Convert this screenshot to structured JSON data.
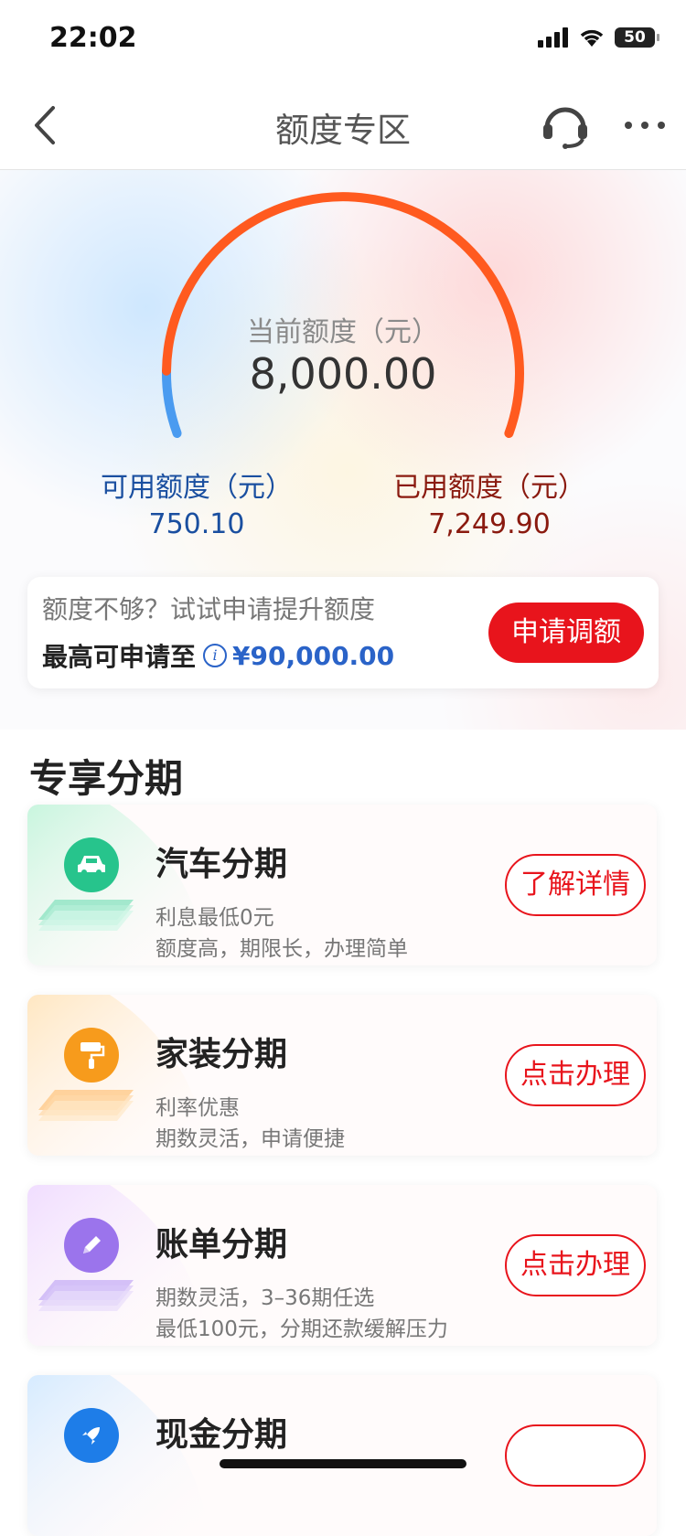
{
  "status_bar": {
    "time": "22:02",
    "battery": "50",
    "icons": [
      "signal-icon",
      "wifi-icon",
      "battery-icon"
    ]
  },
  "nav": {
    "title": "额度专区",
    "back_icon": "chevron-left-icon",
    "service_icon": "headset-icon",
    "more_icon": "more-icon"
  },
  "gauge": {
    "label": "当前额度（元）",
    "total": "8,000.00",
    "used_fraction": 0.906,
    "colors": {
      "used": "#ff5a1f",
      "available": "#4a9bf0"
    }
  },
  "available": {
    "label": "可用额度（元）",
    "value": "750.10"
  },
  "used": {
    "label": "已用额度（元）",
    "value": "7,249.90"
  },
  "raise": {
    "tip": "额度不够？试试申请提升额度",
    "max_label": "最高可申请至",
    "max_amount": "¥90,000.00",
    "button": "申请调额",
    "info_icon": "info-icon"
  },
  "section_title": "专享分期",
  "products": [
    {
      "name": "汽车分期",
      "line1": "利息最低0元",
      "line2": "额度高，期限长，办理简单",
      "button": "了解详情",
      "icon": "car-icon",
      "color": "#27c48c"
    },
    {
      "name": "家装分期",
      "line1": "利率优惠",
      "line2": "期数灵活，申请便捷",
      "button": "点击办理",
      "icon": "paint-roller-icon",
      "color": "#f79b1c"
    },
    {
      "name": "账单分期",
      "line1": "期数灵活，3–36期任选",
      "line2": "最低100元，分期还款缓解压力",
      "button": "点击办理",
      "icon": "pencil-icon",
      "color": "#9b74ec"
    },
    {
      "name": "现金分期",
      "button": "",
      "icon": "rocket-icon",
      "color": "#1e7de8"
    }
  ],
  "colors": {
    "accent_red": "#e8141c",
    "link_blue": "#2a63c8"
  }
}
